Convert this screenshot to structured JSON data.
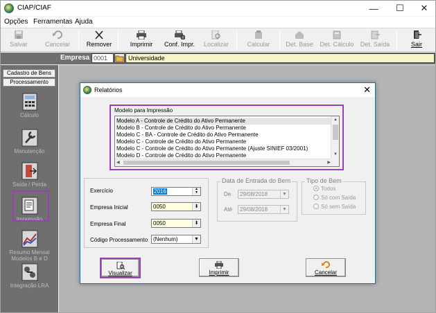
{
  "window": {
    "title": "CIAP/CIAF"
  },
  "menu": [
    "Opções",
    "Ferramentas",
    "Ajuda"
  ],
  "toolbar": {
    "items": [
      {
        "label": "Salvar",
        "icon": "save-icon",
        "enabled": false
      },
      {
        "label": "Cancelar",
        "icon": "undo-icon",
        "enabled": false
      },
      {
        "label": "Remover",
        "icon": "remove-icon",
        "enabled": true
      },
      {
        "label": "Imprimir",
        "icon": "printer-icon",
        "enabled": true
      },
      {
        "label": "Conf. Impr.",
        "icon": "printer-settings-icon",
        "enabled": true
      },
      {
        "label": "Localizar",
        "icon": "find-icon",
        "enabled": false
      },
      {
        "label": "Calcular",
        "icon": "calculate-icon",
        "enabled": false
      },
      {
        "label": "Det. Base",
        "icon": "detail-base-icon",
        "enabled": false
      },
      {
        "label": "Det. Cálculo",
        "icon": "detail-calc-icon",
        "enabled": false
      },
      {
        "label": "Det. Saída",
        "icon": "detail-exit-icon",
        "enabled": false
      },
      {
        "label": "Sair",
        "icon": "exit-door-icon",
        "enabled": true
      }
    ]
  },
  "empresa": {
    "label": "Empresa",
    "code": "0001",
    "name": "Universidade"
  },
  "left_panel": {
    "tabs": [
      "Cadastro de Bens",
      "Processamento"
    ],
    "items": [
      "Cálculo",
      "Manutenção",
      "Saída / Perda",
      "Impressão",
      "Resumo Mensal Modelos B e D",
      "Integração LRA"
    ]
  },
  "dialog": {
    "title": "Relatórios",
    "list_label": "Modelo para Impressão",
    "models": [
      "Modelo A - Controle de Crédito do Ativo Permanente",
      "Modelo B - Controle de Crédito do Ativo Permanente",
      "Modelo C - BA -  Controle de Crédito do Ativo Permanente",
      "Modelo C - Controle de Crédito do Ativo Permanente",
      "Modelo C - Controle de Crédito do Ativo Permanente (Ajuste SINIEF 03/2001)",
      "Modelo D - Controle de Crédito do Ativo Permanente"
    ],
    "fields": {
      "exercicio": {
        "label": "Exercício",
        "value": "2016"
      },
      "empresa_inicial": {
        "label": "Empresa Inicial",
        "value": "0050"
      },
      "empresa_final": {
        "label": "Empresa Final",
        "value": "0050"
      },
      "codigo_processamento": {
        "label": "Código Processamento",
        "value": "(Nenhum)"
      }
    },
    "data_entrada": {
      "title": "Data de Entrada do Bem",
      "de_label": "De",
      "de_value": "29/08/2018",
      "ate_label": "Até",
      "ate_value": "29/08/2018"
    },
    "tipo_bem": {
      "title": "Tipo de Bem",
      "options": [
        "Todos",
        "Só com Saída",
        "Só sem Saída"
      ]
    },
    "buttons": {
      "visualizar": "Visualizar",
      "imprimir": "Imprimir",
      "cancelar": "Cancelar"
    }
  },
  "colors": {
    "highlight": "#9b3fb5",
    "chrome_dark": "#6f6f6f",
    "main_bg": "#b4b4b4",
    "dialog_border": "#0078d7"
  }
}
